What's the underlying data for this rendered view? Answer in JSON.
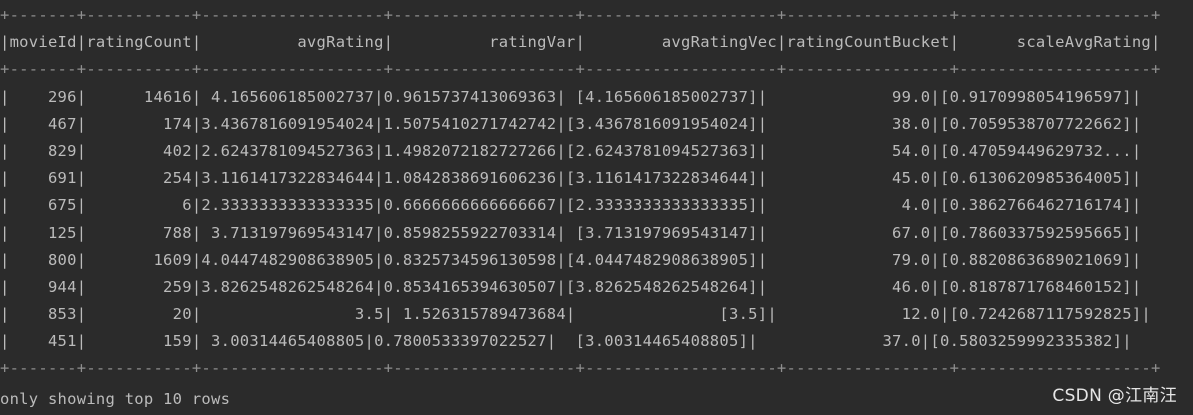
{
  "console": {
    "top_separator": "+-------+-----------+-------------------+-------------------+--------------------+-----------------+--------------------+",
    "header": "|movieId|ratingCount|          avgRating|          ratingVar|        avgRatingVec|ratingCountBucket|      scaleAvgRating|",
    "mid_separator": "+-------+-----------+-------------------+-------------------+--------------------+-----------------+--------------------+",
    "rows": [
      "|    296|      14616| 4.165606185002737|0.9615737413069363| [4.165606185002737]|             99.0|[0.9170998054196597]|",
      "|    467|        174|3.4367816091954024|1.5075410271742742|[3.4367816091954024]|             38.0|[0.7059538707722662]|",
      "|    829|        402|2.6243781094527363|1.4982072182727266|[2.6243781094527363]|             54.0|[0.47059449629732...|",
      "|    691|        254|3.1161417322834644|1.0842838691606236|[3.1161417322834644]|             45.0|[0.6130620985364005]|",
      "|    675|          6|2.3333333333333335|0.6666666666666667|[2.3333333333333335]|              4.0|[0.3862766462716174]|",
      "|    125|        788| 3.713197969543147|0.8598255922703314| [3.713197969543147]|             67.0|[0.7860337592595665]|",
      "|    800|       1609|4.0447482908638905|0.8325734596130598|[4.0447482908638905]|             79.0|[0.8820863689021069]|",
      "|    944|        259|3.8262548262548264|0.8534165394630507|[3.8262548262548264]|             46.0|[0.8187871768460152]|",
      "|    853|         20|                3.5| 1.526315789473684|               [3.5]|             12.0|[0.7242687117592825]|",
      "|    451|        159| 3.00314465408805|0.7800533397022527|  [3.00314465408805]|             37.0|[0.5803259992335382]|"
    ],
    "bottom_separator": "+-------+-----------+-------------------+-------------------+--------------------+-----------------+--------------------+",
    "footer": "only showing top 10 rows"
  },
  "watermark": "CSDN @江南汪"
}
